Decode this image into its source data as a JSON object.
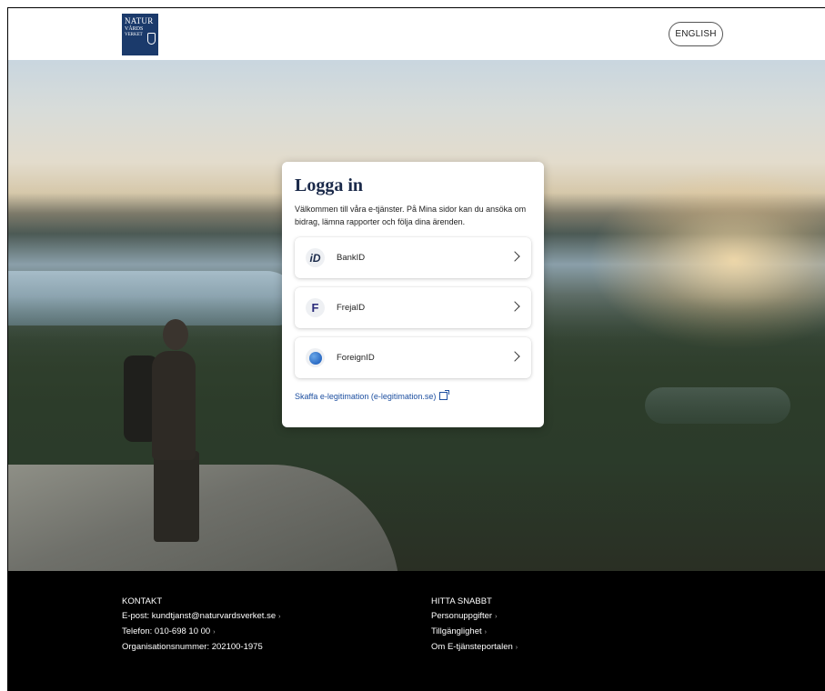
{
  "header": {
    "logo": {
      "line1": "NATUR",
      "line2": "VÅRDS",
      "line3": "VERKET"
    },
    "language_button": "ENGLISH"
  },
  "login": {
    "title": "Logga in",
    "description": "Välkommen till våra e-tjänster. På Mina sidor kan du ansöka om bidrag, lämna rapporter och följa dina ärenden.",
    "methods": [
      {
        "label": "BankID",
        "icon": "bankid-icon"
      },
      {
        "label": "FrejaID",
        "icon": "frejaid-icon"
      },
      {
        "label": "ForeignID",
        "icon": "foreignid-icon"
      }
    ],
    "link": "Skaffa e-legitimation (e-legitimation.se)"
  },
  "footer": {
    "contact": {
      "heading": "KONTAKT",
      "email": "E-post: kundtjanst@naturvardsverket.se",
      "phone": "Telefon: 010-698 10 00",
      "org": "Organisationsnummer: 202100-1975"
    },
    "quick": {
      "heading": "HITTA SNABBT",
      "links": [
        "Personuppgifter",
        "Tillgänglighet",
        "Om E-tjänsteportalen"
      ]
    }
  }
}
